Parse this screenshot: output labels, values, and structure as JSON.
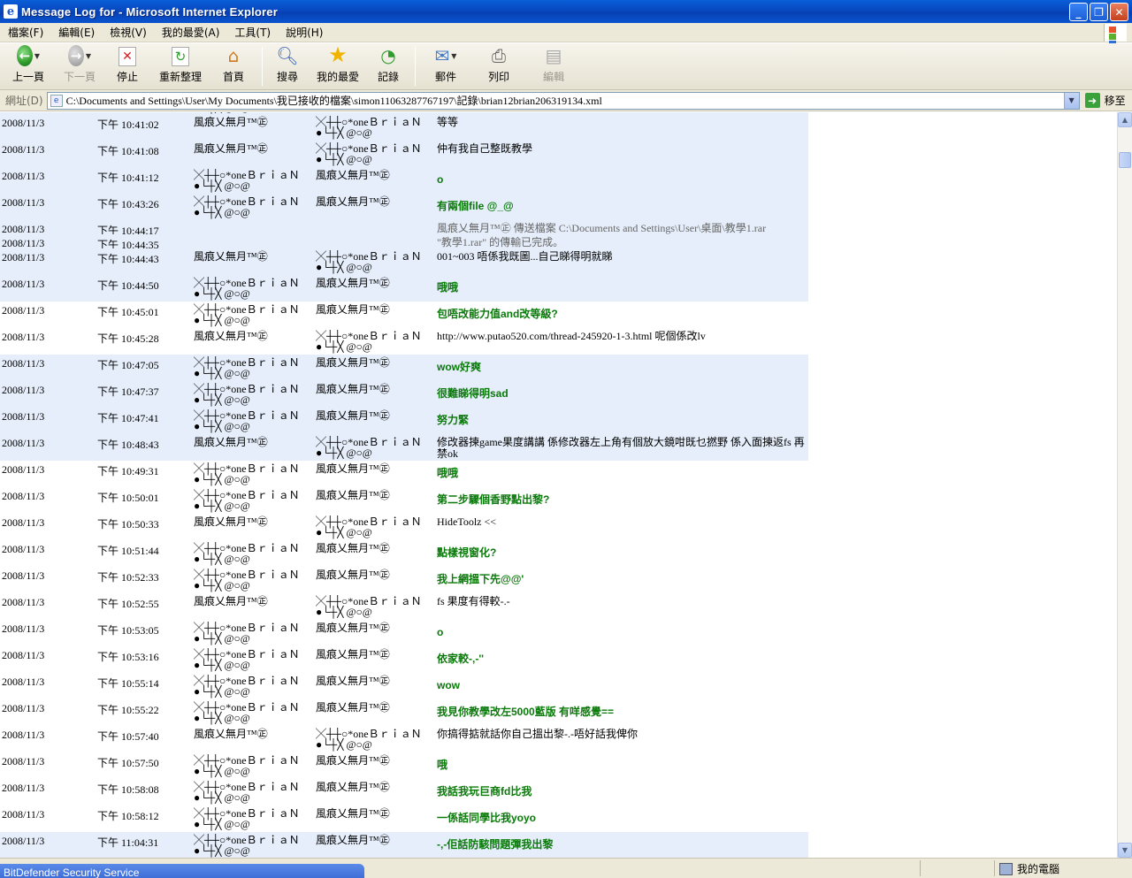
{
  "window": {
    "title": "Message Log for - Microsoft Internet Explorer",
    "app_icon": "e"
  },
  "menu": [
    "檔案(F)",
    "編輯(E)",
    "檢視(V)",
    "我的最愛(A)",
    "工具(T)",
    "說明(H)"
  ],
  "toolbar": {
    "back": "上一頁",
    "forward": "下一頁",
    "stop": "停止",
    "refresh": "重新整理",
    "home": "首頁",
    "search": "搜尋",
    "favorites": "我的最愛",
    "history": "記錄",
    "mail": "郵件",
    "print": "列印",
    "edit": "編輯"
  },
  "address": {
    "label": "網址(D)",
    "value": "C:\\Documents and Settings\\User\\My Documents\\我已接收的檔案\\simon11063287767197\\記錄\\brian12brian206319134.xml",
    "go": "移至"
  },
  "nicks": {
    "brian_l1": "╳┼┼○*oneＢｒｉａＮ",
    "brian_l2": "●└┼╳ @○@",
    "wind": "風痕乂無月™㊣"
  },
  "log": {
    "date": "2008/11/3",
    "rows": [
      {
        "time": "下午 10:41:02",
        "from": "wind",
        "to": "brian",
        "msg": "等等",
        "style": "plain",
        "bg": "blue"
      },
      {
        "time": "下午 10:41:08",
        "from": "wind",
        "to": "brian",
        "msg": "仲有我自己整既教學",
        "style": "plain",
        "bg": "blue"
      },
      {
        "time": "下午 10:41:12",
        "from": "brian",
        "to": "wind",
        "msg": "o",
        "style": "green",
        "bg": "blue"
      },
      {
        "time": "下午 10:43:26",
        "from": "brian",
        "to": "wind",
        "msg": "有兩個file @_@",
        "style": "green",
        "bg": "blue"
      },
      {
        "time": "下午 10:44:17",
        "from": "",
        "to": "",
        "msg": "風痕乂無月™㊣  傳送檔案 C:\\Documents and Settings\\User\\桌面\\教學1.rar",
        "style": "gray",
        "bg": "blue",
        "kind": "short"
      },
      {
        "time": "下午 10:44:35",
        "from": "",
        "to": "",
        "msg": "\"教學1.rar\" 的傳輸已完成。",
        "style": "gray",
        "bg": "blue",
        "kind": "short"
      },
      {
        "time": "下午 10:44:43",
        "from": "wind",
        "to": "brian",
        "msg": "001~003 唔係我既圖...自己睇得明就睇",
        "style": "plain",
        "bg": "blue"
      },
      {
        "time": "下午 10:44:50",
        "from": "brian",
        "to": "wind",
        "msg": "哦哦",
        "style": "green",
        "bg": "blue"
      },
      {
        "time": "下午 10:45:01",
        "from": "brian",
        "to": "wind",
        "msg": "包唔改能力值and改等級?",
        "style": "green",
        "bg": "white"
      },
      {
        "time": "下午 10:45:28",
        "from": "wind",
        "to": "brian",
        "msg": "http://www.putao520.com/thread-245920-1-3.html 呢個係改lv",
        "style": "plain",
        "bg": "white"
      },
      {
        "time": "下午 10:47:05",
        "from": "brian",
        "to": "wind",
        "msg": "wow好爽",
        "style": "green",
        "bg": "blue"
      },
      {
        "time": "下午 10:47:37",
        "from": "brian",
        "to": "wind",
        "msg": "很難睇得明sad",
        "style": "green",
        "bg": "blue"
      },
      {
        "time": "下午 10:47:41",
        "from": "brian",
        "to": "wind",
        "msg": "努力緊",
        "style": "green",
        "bg": "blue"
      },
      {
        "time": "下午 10:48:43",
        "from": "wind",
        "to": "brian",
        "msg": "修改器揀game果度講講 係修改器左上角有個放大鏡咁既乜撚野 係入面揀返fs 再禁ok",
        "style": "plain",
        "bg": "blue"
      },
      {
        "time": "下午 10:49:31",
        "from": "brian",
        "to": "wind",
        "msg": "哦哦",
        "style": "green",
        "bg": "white"
      },
      {
        "time": "下午 10:50:01",
        "from": "brian",
        "to": "wind",
        "msg": "第二步驟個香野點出黎?",
        "style": "green",
        "bg": "white"
      },
      {
        "time": "下午 10:50:33",
        "from": "wind",
        "to": "brian",
        "msg": "HideToolz <<",
        "style": "plain",
        "bg": "white"
      },
      {
        "time": "下午 10:51:44",
        "from": "brian",
        "to": "wind",
        "msg": "點樣視窗化?",
        "style": "green",
        "bg": "white"
      },
      {
        "time": "下午 10:52:33",
        "from": "brian",
        "to": "wind",
        "msg": "我上網搵下先@@'",
        "style": "green",
        "bg": "white"
      },
      {
        "time": "下午 10:52:55",
        "from": "wind",
        "to": "brian",
        "msg": "fs 果度有得較-.-",
        "style": "plain",
        "bg": "white"
      },
      {
        "time": "下午 10:53:05",
        "from": "brian",
        "to": "wind",
        "msg": "o",
        "style": "green",
        "bg": "white"
      },
      {
        "time": "下午 10:53:16",
        "from": "brian",
        "to": "wind",
        "msg": "依家較-,-''",
        "style": "green",
        "bg": "white"
      },
      {
        "time": "下午 10:55:14",
        "from": "brian",
        "to": "wind",
        "msg": "wow",
        "style": "green",
        "bg": "white"
      },
      {
        "time": "下午 10:55:22",
        "from": "brian",
        "to": "wind",
        "msg": "我見你教學改左5000藍版 有咩感覺==",
        "style": "green",
        "bg": "white"
      },
      {
        "time": "下午 10:57:40",
        "from": "wind",
        "to": "brian",
        "msg": "你搞得掂就話你自己搵出黎-.-唔好話我俾你",
        "style": "plain",
        "bg": "white"
      },
      {
        "time": "下午 10:57:50",
        "from": "brian",
        "to": "wind",
        "msg": "哦",
        "style": "green",
        "bg": "white"
      },
      {
        "time": "下午 10:58:08",
        "from": "brian",
        "to": "wind",
        "msg": "我話我玩巨商fd比我",
        "style": "green",
        "bg": "white"
      },
      {
        "time": "下午 10:58:12",
        "from": "brian",
        "to": "wind",
        "msg": "一係話同學比我yoyo",
        "style": "green",
        "bg": "white"
      },
      {
        "time": "下午 11:04:31",
        "from": "brian",
        "to": "wind",
        "msg": "-,-佢話防駭問題彈我出黎",
        "style": "green",
        "bg": "blue"
      }
    ]
  },
  "status": {
    "zone": "我的電腦",
    "popup": "BitDefender Security Service"
  },
  "colors": {
    "titlebar": "#0848c0",
    "row_highlight": "#e5eefa",
    "green_msg": "#0a7a0a",
    "chrome": "#ece9d8"
  }
}
